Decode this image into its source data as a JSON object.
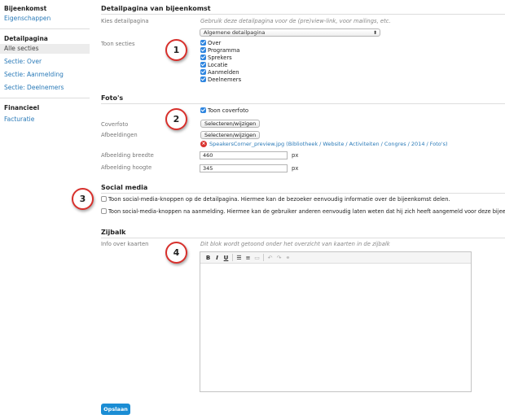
{
  "sidebar": {
    "groups": [
      {
        "heading": "Bijeenkomst",
        "items": [
          "Eigenschappen"
        ]
      },
      {
        "heading": "Detailpagina",
        "items": [
          "Alle secties",
          "Sectie: Over",
          "Sectie: Aanmelding",
          "Sectie: Deelnemers"
        ]
      },
      {
        "heading": "Financieel",
        "items": [
          "Facturatie"
        ]
      }
    ],
    "active_item": "Alle secties"
  },
  "detail": {
    "title": "Detailpagina van bijeenkomst",
    "choose_label": "Kies detailpagina",
    "choose_help": "Gebruik deze detailpagina voor de (pre)view-link, voor mailings, etc.",
    "select_value": "Algemene detailpagina",
    "sections_label": "Toon secties",
    "sections": [
      {
        "label": "Over",
        "checked": true
      },
      {
        "label": "Programma",
        "checked": true
      },
      {
        "label": "Sprekers",
        "checked": true
      },
      {
        "label": "Locatie",
        "checked": true
      },
      {
        "label": "Aanmelden",
        "checked": true
      },
      {
        "label": "Deelnemers",
        "checked": true
      }
    ]
  },
  "photos": {
    "title": "Foto's",
    "show_cover_label": "Toon coverfoto",
    "show_cover_checked": true,
    "cover_label": "Coverfoto",
    "cover_button": "Selecteren/wijzigen",
    "images_label": "Afbeeldingen",
    "images_button": "Selecteren/wijzigen",
    "image_file": "SpeakersCorner_preview.jpg (Bibliotheek / Website / Activiteiten / Congres / 2014 / Foto's)",
    "width_label": "Afbeelding breedte",
    "width_value": "460",
    "height_label": "Afbeelding hoogte",
    "height_value": "345",
    "unit": "px"
  },
  "social": {
    "title": "Social media",
    "option1": "Toon social-media-knoppen op de detailpagina. Hiermee kan de bezoeker eenvoudig informatie over de bijeenkomst delen.",
    "option2": "Toon social-media-knoppen na aanmelding. Hiermee kan de gebruiker anderen eenvoudig laten weten dat hij zich heeft aangemeld voor deze bijeenkomst.",
    "option1_checked": false,
    "option2_checked": false
  },
  "sidebar_block": {
    "title": "Zijbalk",
    "info_label": "Info over kaarten",
    "info_help": "Dit blok wordt getoond onder het overzicht van kaarten in de zijbalk",
    "toolbar": [
      "B",
      "I",
      "U",
      "bullet-list",
      "numbered-list",
      "hr",
      "undo",
      "redo",
      "link"
    ]
  },
  "save_label": "Opslaan",
  "callouts": [
    "1",
    "2",
    "3",
    "4"
  ],
  "colors": {
    "link": "#2a7ab8",
    "accent": "#1b8dd4",
    "callout": "#d8302c"
  }
}
